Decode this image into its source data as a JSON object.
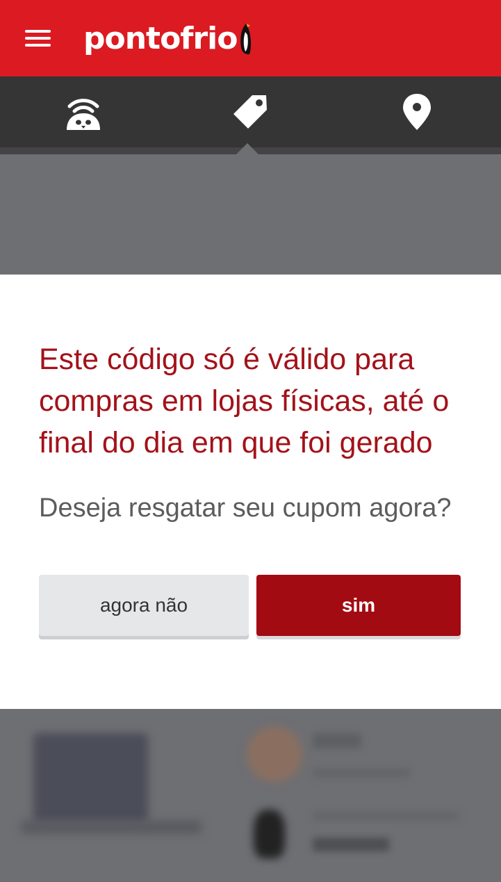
{
  "header": {
    "logo_text": "pontofrio",
    "brand_color": "#db1a22"
  },
  "tabs": [
    {
      "icon": "wifi-penguin-icon"
    },
    {
      "icon": "tag-icon",
      "active": true
    },
    {
      "icon": "location-pin-icon"
    }
  ],
  "dialog": {
    "title": "Este código só é válido para compras em lojas físicas, até o final do dia em que foi gerado",
    "question": "Deseja resgatar seu cupom agora?",
    "no_label": "agora não",
    "yes_label": "sim",
    "accent_color": "#a20b12"
  }
}
